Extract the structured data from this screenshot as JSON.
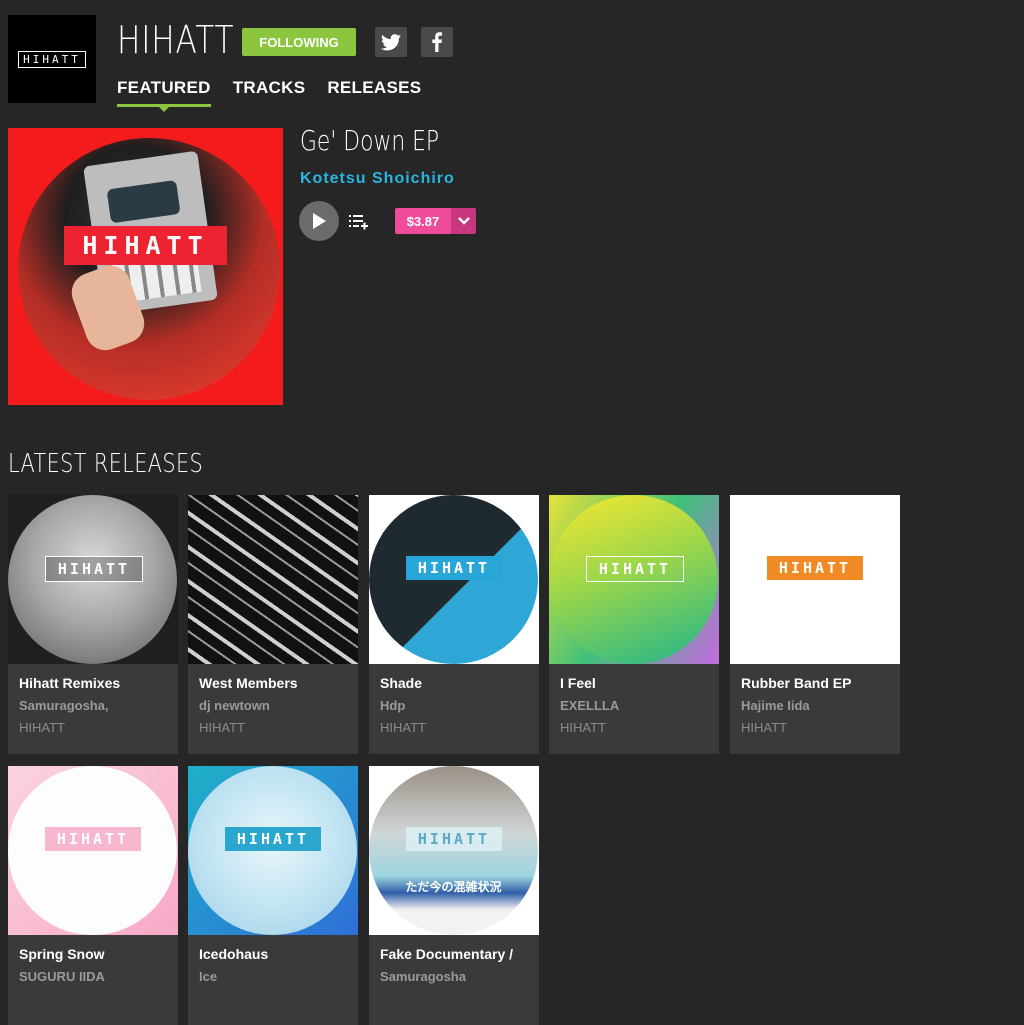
{
  "header": {
    "logo_text": "HIHATT",
    "name": "HIHATT",
    "follow_label": "FOLLOWING",
    "follow_color": "#8cc63f",
    "social": [
      "twitter-icon",
      "facebook-icon"
    ],
    "tabs": [
      {
        "label": "FEATURED",
        "active": true
      },
      {
        "label": "TRACKS",
        "active": false
      },
      {
        "label": "RELEASES",
        "active": false
      }
    ]
  },
  "featured": {
    "title": "Ge' Down EP",
    "artist": "Kotetsu Shoichiro",
    "artist_color": "#29b6e0",
    "art_label": "HIHATT",
    "price": "$3.87",
    "price_color": "#ee4b9b"
  },
  "latest": {
    "heading": "LATEST RELEASES",
    "releases": [
      {
        "title": "Hihatt Remixes",
        "artist": "Samuragosha,",
        "label": "HIHATT",
        "art_label": "HIHATT"
      },
      {
        "title": "West Members",
        "artist": "dj newtown",
        "label": "HIHATT",
        "art_label": ""
      },
      {
        "title": "Shade",
        "artist": "Hdp",
        "label": "HIHATT",
        "art_label": "HIHATT"
      },
      {
        "title": "I Feel",
        "artist": "EXELLLA",
        "label": "HIHATT",
        "art_label": "HIHATT"
      },
      {
        "title": "Rubber Band EP",
        "artist": "Hajime Iida",
        "label": "HIHATT",
        "art_label": "HIHATT"
      },
      {
        "title": "Spring Snow",
        "artist": "SUGURU IIDA",
        "label": "",
        "art_label": "HIHATT"
      },
      {
        "title": "Icedohaus",
        "artist": "Ice",
        "label": "",
        "art_label": "HIHATT"
      },
      {
        "title": "Fake Documentary /",
        "artist": "Samuragosha",
        "label": "",
        "art_label": "HIHATT",
        "art_caption": "ただ今の混雑状況"
      }
    ]
  }
}
